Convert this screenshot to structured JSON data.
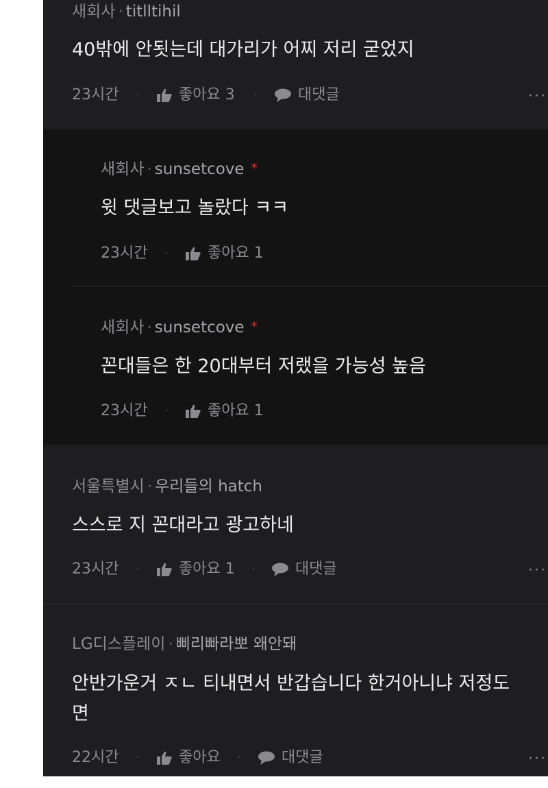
{
  "comments": [
    {
      "location": "새회사",
      "author": "titlltihil",
      "text": "40밖에 안됫는데 대가리가 어찌 저리 굳었지",
      "time": "23시간",
      "likes_label": "좋아요 3",
      "reply_label": "대댓글",
      "replies": [
        {
          "location": "새회사",
          "author": "sunsetcove",
          "badge": "*",
          "text": "윗 댓글보고 놀랐다 ㅋㅋ",
          "time": "23시간",
          "likes_label": "좋아요 1"
        },
        {
          "location": "새회사",
          "author": "sunsetcove",
          "badge": "*",
          "text": "꼰대들은 한 20대부터 저랬을 가능성 높음",
          "time": "23시간",
          "likes_label": "좋아요 1"
        }
      ]
    },
    {
      "location": "서울특별시",
      "author": "우리들의 hatch",
      "text": "스스로 지 꼰대라고 광고하네",
      "time": "23시간",
      "likes_label": "좋아요 1",
      "reply_label": "대댓글"
    },
    {
      "location": "LG디스플레이",
      "author": "삐리빠라뽀 왜안돼",
      "text_line1": "안반가운거 ㅈㄴ 티내면서 반갑습니다 한거아니냐 저정도",
      "text_line2": "면",
      "time": "22시간",
      "likes_label": "좋아요",
      "reply_label": "대댓글"
    }
  ],
  "ui": {
    "separator": "·",
    "more": "···",
    "colors": {
      "background": "#1e1e20",
      "reply_background": "#131314",
      "text": "#ececee",
      "muted": "#8b8b8f",
      "badge": "#d9353a"
    },
    "icons": {
      "like": "thumbs-up-icon",
      "reply": "speech-bubble-icon",
      "more": "more-dots-icon"
    }
  }
}
